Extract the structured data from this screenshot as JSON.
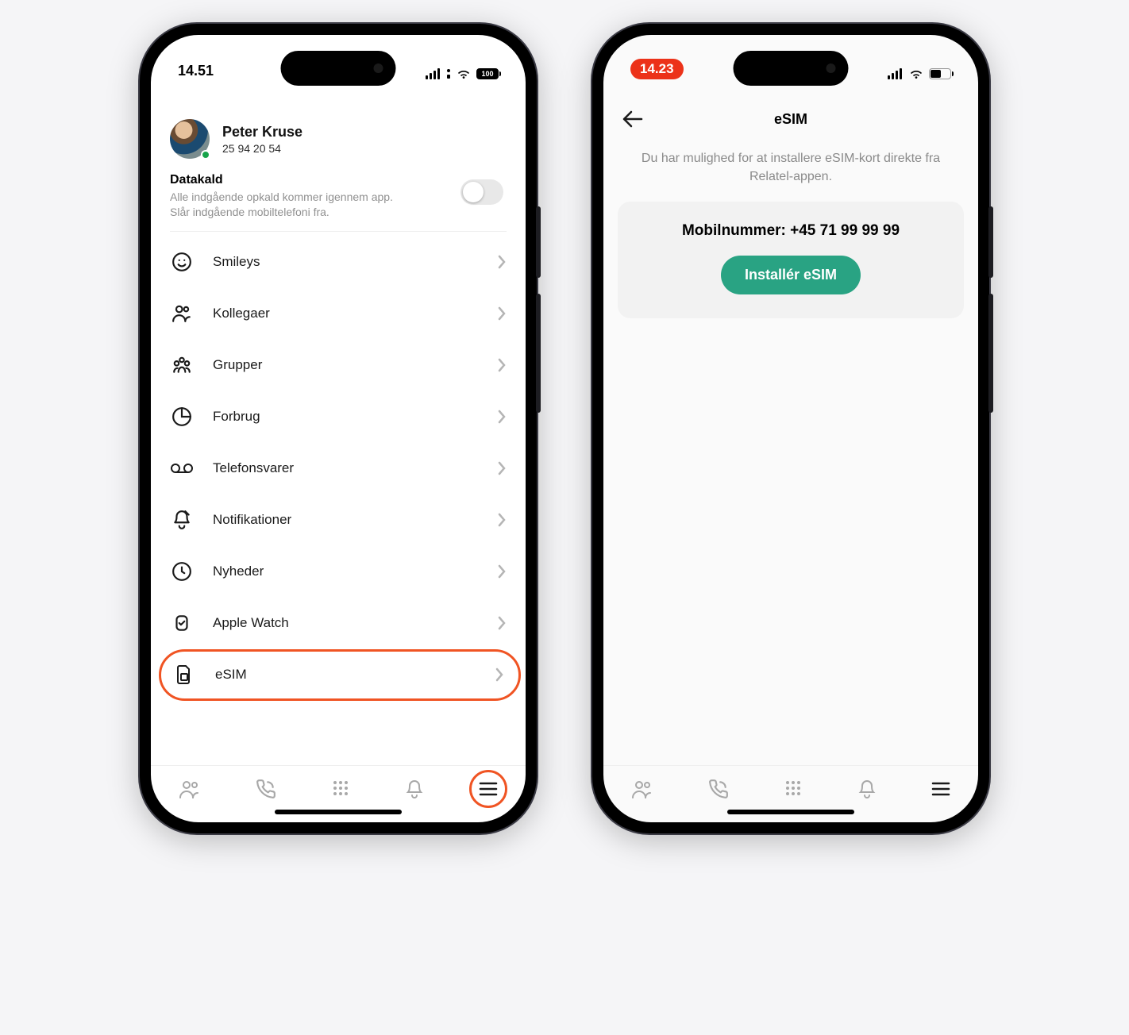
{
  "left": {
    "status": {
      "time": "14.51",
      "battery": "100"
    },
    "profile": {
      "name": "Peter Kruse",
      "number": "25 94 20 54"
    },
    "datakald": {
      "title": "Datakald",
      "line1": "Alle indgående opkald kommer igennem app.",
      "line2": "Slår indgående mobiltelefoni fra."
    },
    "menu": {
      "item0": "Smileys",
      "item1": "Kollegaer",
      "item2": "Grupper",
      "item3": "Forbrug",
      "item4": "Telefonsvarer",
      "item5": "Notifikationer",
      "item6": "Nyheder",
      "item7": "Apple Watch",
      "item8": "eSIM"
    }
  },
  "right": {
    "status": {
      "time": "14.23"
    },
    "header": {
      "title": "eSIM"
    },
    "hint": "Du har mulighed for at installere eSIM-kort direkte fra Relatel-appen.",
    "card": {
      "mobil_label": "Mobilnummer: ",
      "mobil_value": "+45 71 99 99 99",
      "button": "Installér eSIM"
    }
  }
}
